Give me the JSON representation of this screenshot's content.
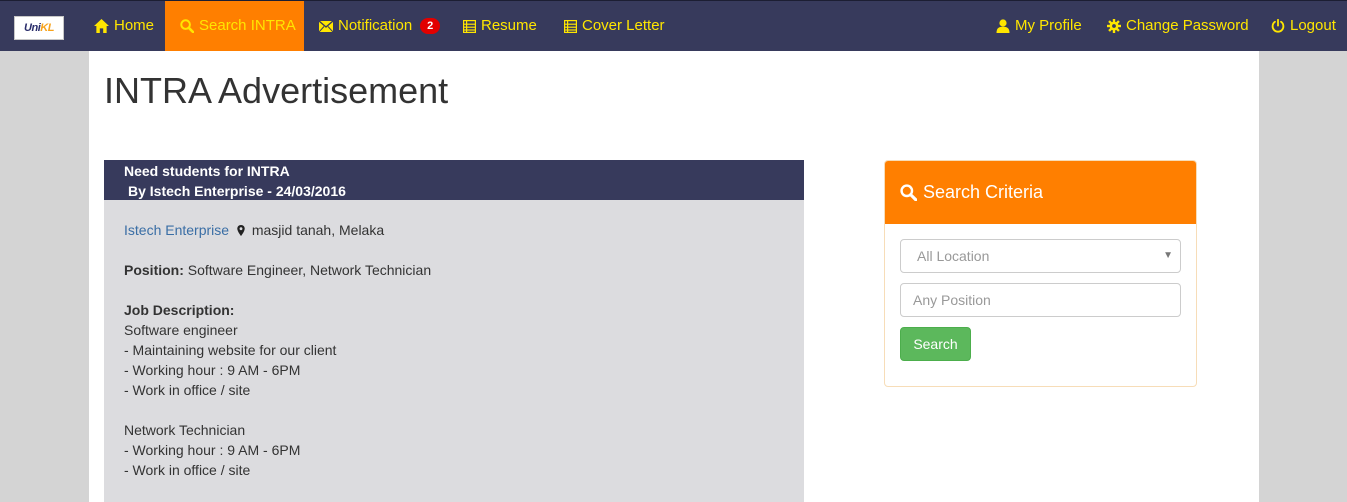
{
  "brand": {
    "logo_uni": "Uni",
    "logo_kl": "KL"
  },
  "nav": {
    "home": "Home",
    "search_intra": "Search INTRA",
    "notification": "Notification",
    "notification_count": "2",
    "resume": "Resume",
    "cover_letter": "Cover Letter",
    "my_profile": "My Profile",
    "change_password": "Change Password",
    "logout": "Logout"
  },
  "page": {
    "title": "INTRA Advertisement"
  },
  "ad": {
    "title": "Need students for INTRA",
    "byline": "By Istech Enterprise - 24/03/2016",
    "company": "Istech Enterprise",
    "location": "masjid tanah, Melaka",
    "position_label": "Position:",
    "position_value": "Software Engineer, Network Technician",
    "job_desc_label": "Job Description:",
    "desc_lines": [
      "Software engineer",
      "- Maintaining website for our client",
      "- Working hour : 9 AM - 6PM",
      "- Work in office / site",
      "",
      "Network Technician",
      "- Working hour : 9 AM - 6PM",
      "- Work in office / site"
    ]
  },
  "search": {
    "heading": "Search Criteria",
    "location_selected": "All Location",
    "position_placeholder": "Any Position",
    "button": "Search"
  },
  "colors": {
    "navbar": "#373a5c",
    "nav_text": "#ffe600",
    "accent_orange": "#ff7f00",
    "button_green": "#5cb85c",
    "badge_red": "#e20000",
    "ad_body": "#dcdcdf"
  },
  "icons": {
    "home": "home-icon",
    "search": "search-icon",
    "notification": "envelope-icon",
    "resume": "list-icon",
    "cover_letter": "list-icon",
    "profile": "user-icon",
    "password": "gear-icon",
    "logout": "power-icon",
    "location": "map-marker-icon"
  }
}
